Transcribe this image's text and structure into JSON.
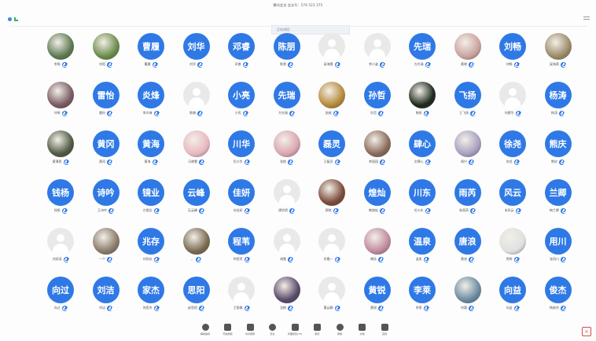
{
  "window": {
    "title": "腾讯会议 会议号：574 523 375"
  },
  "speaking_banner": "正在讲话：",
  "colors": {
    "accent": "#2f79e6",
    "mic": "#2f79e6",
    "danger": "#d84a4a"
  },
  "participants": [
    {
      "avatar": "photo",
      "label": "",
      "name": "余杨",
      "color": "#5c7a52"
    },
    {
      "avatar": "photo",
      "label": "",
      "name": "刘阳",
      "color": "#6b8c4a"
    },
    {
      "avatar": "text",
      "label": "曹履",
      "name": "曹履"
    },
    {
      "avatar": "text",
      "label": "刘华",
      "name": "刘华"
    },
    {
      "avatar": "text",
      "label": "邓睿",
      "name": "邓睿"
    },
    {
      "avatar": "text",
      "label": "陈朋",
      "name": "陈朋"
    },
    {
      "avatar": "default",
      "label": "",
      "name": "梁海霞"
    },
    {
      "avatar": "default",
      "label": "",
      "name": "李小姿"
    },
    {
      "avatar": "text",
      "label": "先瑞",
      "name": "方先瑞"
    },
    {
      "avatar": "photo",
      "label": "",
      "name": "黄晓",
      "color": "#c9a3a0"
    },
    {
      "avatar": "text",
      "label": "刘畅",
      "name": "刘畅"
    },
    {
      "avatar": "photo",
      "label": "",
      "name": "梁海燕",
      "color": "#9b8a6a"
    },
    {
      "avatar": "photo",
      "label": "",
      "name": "刘琴",
      "color": "#7a5a62"
    },
    {
      "avatar": "text",
      "label": "雷怡",
      "name": "雷怡"
    },
    {
      "avatar": "text",
      "label": "炎烽",
      "name": "李炎烽"
    },
    {
      "avatar": "default",
      "label": "",
      "name": "陈娟"
    },
    {
      "avatar": "text",
      "label": "小亮",
      "name": "小亮"
    },
    {
      "avatar": "text",
      "label": "先瑞",
      "name": "方先瑞"
    },
    {
      "avatar": "photo",
      "label": "",
      "name": "张婉",
      "color": "#b58a3a"
    },
    {
      "avatar": "text",
      "label": "孙哲",
      "name": "孙哲"
    },
    {
      "avatar": "photo",
      "label": "",
      "name": "杨帆",
      "color": "#1e2a1e"
    },
    {
      "avatar": "text",
      "label": "飞扬",
      "name": "王飞扬"
    },
    {
      "avatar": "default",
      "label": "",
      "name": "刘建华"
    },
    {
      "avatar": "text",
      "label": "杨涛",
      "name": "杨涛"
    },
    {
      "avatar": "photo",
      "label": "",
      "name": "黄薄思",
      "color": "#4f5a44"
    },
    {
      "avatar": "text",
      "label": "黄冈",
      "name": "黄冈"
    },
    {
      "avatar": "text",
      "label": "黄海",
      "name": "黄海"
    },
    {
      "avatar": "photo",
      "label": "",
      "name": "马晓雯",
      "color": "#e8b8c0"
    },
    {
      "avatar": "text",
      "label": "川华",
      "name": "任川华"
    },
    {
      "avatar": "photo",
      "label": "",
      "name": "张航",
      "color": "#d9a6b0"
    },
    {
      "avatar": "text",
      "label": "磊灵",
      "name": "王磊灵"
    },
    {
      "avatar": "photo",
      "label": "",
      "name": "李丽园",
      "color": "#8a6a5a"
    },
    {
      "avatar": "text",
      "label": "肆心",
      "name": "文肆心"
    },
    {
      "avatar": "photo",
      "label": "",
      "name": "周兴",
      "color": "#a8a0c0"
    },
    {
      "avatar": "text",
      "label": "徐尧",
      "name": "徐尧"
    },
    {
      "avatar": "text",
      "label": "熊庆",
      "name": "熊庆"
    },
    {
      "avatar": "text",
      "label": "钱杨",
      "name": "钱杨"
    },
    {
      "avatar": "text",
      "label": "诗吟",
      "name": "王诗吟"
    },
    {
      "avatar": "text",
      "label": "镜业",
      "name": "方镜业"
    },
    {
      "avatar": "text",
      "label": "云峰",
      "name": "石云峰"
    },
    {
      "avatar": "text",
      "label": "佳妍",
      "name": "向佳妍"
    },
    {
      "avatar": "default",
      "label": "",
      "name": "谭学娇"
    },
    {
      "avatar": "photo",
      "label": "",
      "name": "郭晓",
      "color": "#7a4a3a"
    },
    {
      "avatar": "text",
      "label": "煌灿",
      "name": "韩煌灿"
    },
    {
      "avatar": "text",
      "label": "川东",
      "name": "任川东"
    },
    {
      "avatar": "text",
      "label": "雨芮",
      "name": "朱雨芮"
    },
    {
      "avatar": "text",
      "label": "风云",
      "name": "宋风云"
    },
    {
      "avatar": "text",
      "label": "兰卿",
      "name": "梅兰卿"
    },
    {
      "avatar": "default",
      "label": "",
      "name": "刘润涛"
    },
    {
      "avatar": "photo",
      "label": "",
      "name": "一个",
      "color": "#8a7a6a"
    },
    {
      "avatar": "text",
      "label": "兆存",
      "name": "刘兆存"
    },
    {
      "avatar": "photo",
      "label": "",
      "name": "，",
      "color": "#7a6a52"
    },
    {
      "avatar": "text",
      "label": "程苇",
      "name": "仲程苇"
    },
    {
      "avatar": "default",
      "label": "",
      "name": "胡霞"
    },
    {
      "avatar": "default",
      "label": "",
      "name": "邓霞一"
    },
    {
      "avatar": "photo",
      "label": "",
      "name": "傅泳",
      "color": "#c08aa0"
    },
    {
      "avatar": "text",
      "label": "温泉",
      "name": "温泉"
    },
    {
      "avatar": "text",
      "label": "唐浪",
      "name": "黄浪"
    },
    {
      "avatar": "photo",
      "label": "",
      "name": "贺辉",
      "color": "#e0e0e0"
    },
    {
      "avatar": "text",
      "label": "用川",
      "name": "张用川"
    },
    {
      "avatar": "text",
      "label": "向过",
      "name": "向过"
    },
    {
      "avatar": "text",
      "label": "刘洁",
      "name": "刘洁"
    },
    {
      "avatar": "text",
      "label": "家杰",
      "name": "何家杰"
    },
    {
      "avatar": "text",
      "label": "思阳",
      "name": "赵思阳"
    },
    {
      "avatar": "default",
      "label": "",
      "name": "王智敏"
    },
    {
      "avatar": "photo",
      "label": "",
      "name": "沈桃",
      "color": "#5a4a6a"
    },
    {
      "avatar": "default",
      "label": "",
      "name": "董云静"
    },
    {
      "avatar": "text",
      "label": "黄锐",
      "name": "黄锐"
    },
    {
      "avatar": "text",
      "label": "李莱",
      "name": "李莱"
    },
    {
      "avatar": "photo",
      "label": "",
      "name": "何惠",
      "color": "#6a8aa0"
    },
    {
      "avatar": "text",
      "label": "向益",
      "name": "向益"
    },
    {
      "avatar": "text",
      "label": "俊杰",
      "name": "杨俊杰"
    }
  ],
  "toolbar": [
    {
      "icon": "mic-icon",
      "label": "解除静音"
    },
    {
      "icon": "camera-off-icon",
      "label": "开启视频"
    },
    {
      "icon": "share-screen-icon",
      "label": "共享屏幕"
    },
    {
      "icon": "security-icon",
      "label": "安全"
    },
    {
      "icon": "members-icon",
      "label": "管理成员(73)"
    },
    {
      "icon": "chat-icon",
      "label": "聊天"
    },
    {
      "icon": "record-icon",
      "label": "录制"
    },
    {
      "icon": "doc-icon",
      "label": "文档"
    },
    {
      "icon": "apps-icon",
      "label": "应用"
    }
  ]
}
